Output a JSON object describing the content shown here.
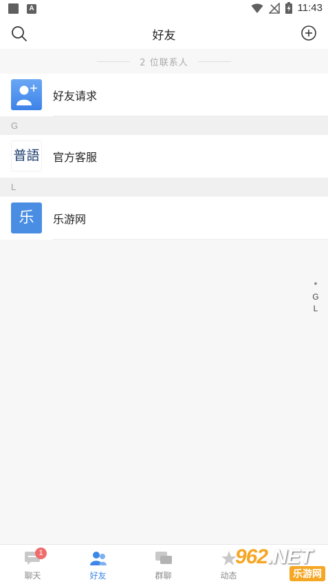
{
  "status_bar": {
    "time": "11:43",
    "app_badge": "A"
  },
  "header": {
    "title": "好友"
  },
  "contacts_count": "2 位联系人",
  "friend_request": {
    "label": "好友请求"
  },
  "sections": [
    {
      "letter": "G",
      "contacts": [
        {
          "name": "官方客服",
          "avatar_text": "普語"
        }
      ]
    },
    {
      "letter": "L",
      "contacts": [
        {
          "name": "乐游网",
          "avatar_text": "乐"
        }
      ]
    }
  ],
  "alphabet_index": [
    "*",
    "G",
    "L"
  ],
  "bottom_nav": {
    "tabs": [
      {
        "label": "聊天",
        "icon": "chat-icon",
        "badge": "1",
        "active": false
      },
      {
        "label": "好友",
        "icon": "friends-icon",
        "active": true
      },
      {
        "label": "群聊",
        "icon": "group-chat-icon",
        "active": false
      },
      {
        "label": "动态",
        "icon": "moments-icon",
        "active": false
      }
    ]
  },
  "watermark": {
    "brand": "962",
    "suffix": ".NET",
    "subtitle": "乐游网"
  },
  "colors": {
    "accent": "#3d87e8",
    "badge": "#f06c6c",
    "section_bg": "#f0f0f0",
    "page_bg": "#f7f7f7"
  }
}
